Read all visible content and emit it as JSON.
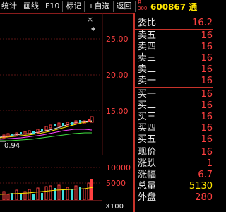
{
  "toolbar": {
    "items": [
      "统计",
      "画线",
      "F10",
      "标记",
      "+自选",
      "返回"
    ]
  },
  "chart": {
    "price_axis": [
      "25.00",
      "20.00",
      "15.00"
    ],
    "low_label": "0.94",
    "volume_axis": [
      "10000",
      "5000"
    ],
    "volume_unit": "X100",
    "close_icon": "×",
    "menu_icon": "◆"
  },
  "quote": {
    "code_prefix": "R",
    "code_sub": "300",
    "code": "600867 通",
    "webi_label": "委比",
    "webi_value": "16.2",
    "asks": [
      {
        "label": "卖五",
        "value": "16"
      },
      {
        "label": "卖四",
        "value": "16"
      },
      {
        "label": "卖三",
        "value": "16"
      },
      {
        "label": "卖二",
        "value": "16"
      },
      {
        "label": "卖一",
        "value": "16"
      }
    ],
    "bids": [
      {
        "label": "买一",
        "value": "16"
      },
      {
        "label": "买二",
        "value": "16"
      },
      {
        "label": "买三",
        "value": "16"
      },
      {
        "label": "买四",
        "value": "16"
      },
      {
        "label": "买五",
        "value": "16"
      }
    ],
    "stats": [
      {
        "label": "现价",
        "value": "16"
      },
      {
        "label": "涨跌",
        "value": "1"
      },
      {
        "label": "涨幅",
        "value": "6.7"
      },
      {
        "label": "总量",
        "value": "5130"
      },
      {
        "label": "外盘",
        "value": "280"
      }
    ]
  }
}
